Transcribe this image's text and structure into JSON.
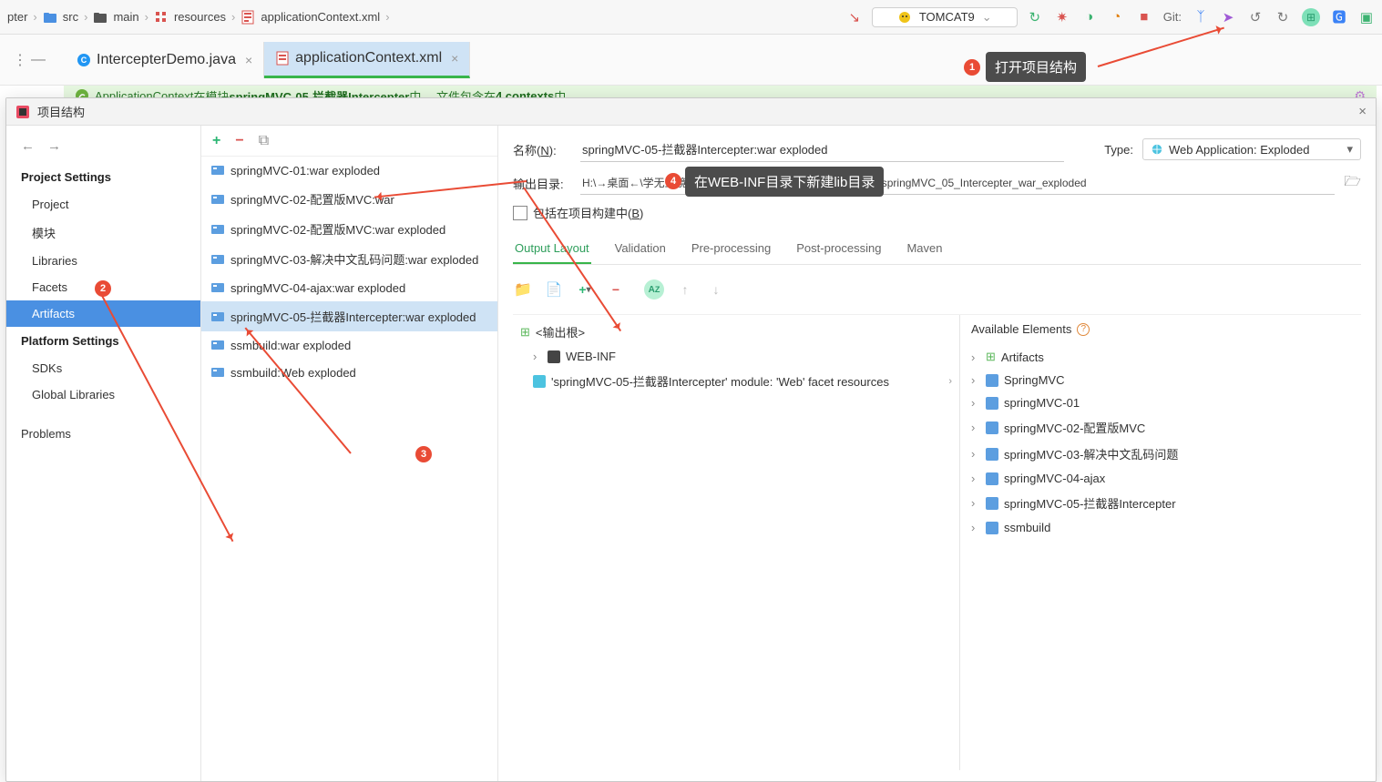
{
  "breadcrumb": {
    "root": "pter",
    "items": [
      "src",
      "main",
      "resources",
      "applicationContext.xml"
    ]
  },
  "run_config": "TOMCAT9",
  "git_label": "Git:",
  "tabs": [
    {
      "label": "IntercepterDemo.java",
      "active": false
    },
    {
      "label": "applicationContext.xml",
      "active": true
    }
  ],
  "banner": {
    "pre": "ApplicationContext",
    "mid1": "  在模块 ",
    "bold": "springMVC-05-拦截器Intercepter",
    "mid2": " 中。  文件包含在 ",
    "bold2": "4 contexts",
    "tail": " 中"
  },
  "dialog": {
    "title": "项目结构",
    "nav": {
      "section1": "Project Settings",
      "items1": [
        "Project",
        "模块",
        "Libraries",
        "Facets",
        "Artifacts"
      ],
      "selected1": "Artifacts",
      "section2": "Platform Settings",
      "items2": [
        "SDKs",
        "Global Libraries"
      ],
      "problems": "Problems"
    },
    "artifacts": [
      "springMVC-01:war exploded",
      "springMVC-02-配置版MVC:war",
      "springMVC-02-配置版MVC:war exploded",
      "springMVC-03-解决中文乱码问题:war exploded",
      "springMVC-04-ajax:war exploded",
      "springMVC-05-拦截器Intercepter:war exploded",
      "ssmbuild:war exploded",
      "ssmbuild:Web exploded"
    ],
    "artifact_selected_index": 5,
    "detail": {
      "name_lbl": "名称(",
      "name_key": "N",
      "name_lbl2": "):",
      "name_value": "springMVC-05-拦截器Intercepter:war exploded",
      "type_lbl": "Type:",
      "type_value": "Web Application: Exploded",
      "out_lbl": "输出目录:",
      "out_value": "H:\\→桌面←\\学无止境\\狂神视频_idea\\SpringMVC\\out\\artifacts\\springMVC_05_Intercepter_war_exploded",
      "chk_label": "包括在项目构建中(",
      "chk_key": "B",
      "chk_label2": ")",
      "tabs": [
        "Output Layout",
        "Validation",
        "Pre-processing",
        "Post-processing",
        "Maven"
      ],
      "tab_active": 0,
      "tree": {
        "root": "<输出根>",
        "webinf": "WEB-INF",
        "module_res": "'springMVC-05-拦截器Intercepter' module: 'Web' facet resources"
      },
      "avail": {
        "title": "Available Elements",
        "items": [
          "Artifacts",
          "SpringMVC",
          "springMVC-01",
          "springMVC-02-配置版MVC",
          "springMVC-03-解决中文乱码问题",
          "springMVC-04-ajax",
          "springMVC-05-拦截器Intercepter",
          "ssmbuild"
        ]
      }
    }
  },
  "annotations": {
    "bubble1": "打开项目结构",
    "bubble4": "在WEB-INF目录下新建lib目录"
  }
}
